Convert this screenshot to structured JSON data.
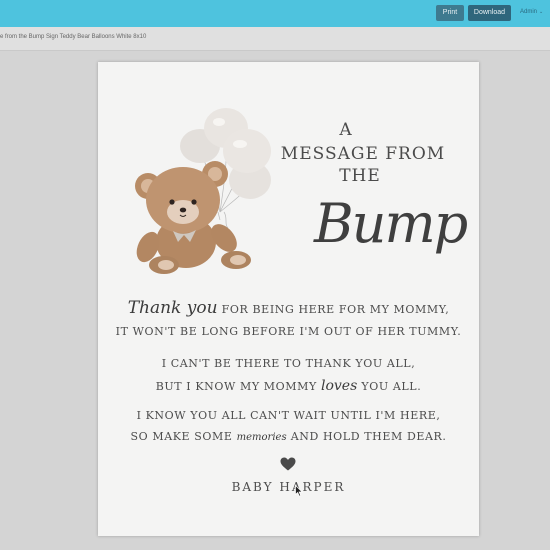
{
  "toolbar": {
    "print_label": "Print",
    "download_label": "Download",
    "user_label": "Admin",
    "user_chevron": "⌄"
  },
  "document": {
    "filename": "e from the Bump Sign Teddy Bear Balloons White 8x10"
  },
  "sign": {
    "title_line1": "A",
    "title_line2": "MESSAGE FROM",
    "title_line3": "THE",
    "title_script": "Bump",
    "poem": {
      "l1_script": "Thank you",
      "l1_rest": "FOR BEING HERE FOR MY MOMMY,",
      "l2": "IT WON'T BE LONG BEFORE I'M OUT OF HER TUMMY.",
      "l3": "I CAN'T BE THERE TO THANK YOU ALL,",
      "l4_pre": "BUT I KNOW MY MOMMY",
      "l4_script": "loves",
      "l4_post": "YOU ALL.",
      "l5": "I KNOW YOU ALL CAN'T WAIT UNTIL I'M HERE,",
      "l6_pre": "SO MAKE SOME",
      "l6_script": "memories",
      "l6_post": "AND HOLD THEM DEAR."
    },
    "signoff": "BABY HARPER"
  },
  "icons": {
    "heart": "heart-icon",
    "bear": "teddy-bear-with-balloons",
    "cursor": "mouse-cursor-icon"
  },
  "colors": {
    "topbar": "#4ec3de",
    "print_button": "#3e7a8f",
    "download_button": "#2f667c",
    "sign_background": "#f4f4f3",
    "text": "#4b4b4b"
  }
}
